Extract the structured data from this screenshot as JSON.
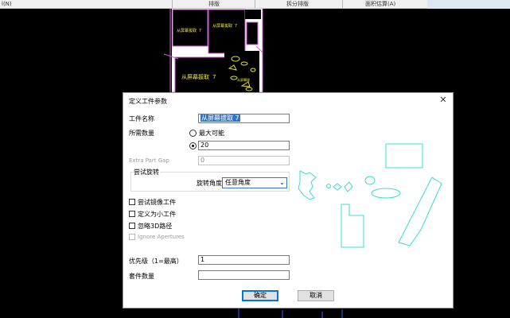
{
  "topbar": {
    "left_text": "l(N)",
    "col1": "排版",
    "col2": "拆分排版",
    "col3": "面积估算(A)"
  },
  "cad": {
    "part_labels": [
      "从屏幕拔取 7",
      "从屏幕拔取 7",
      "从屏幕拔取 7",
      "从屏幕拔"
    ]
  },
  "dialog": {
    "title": "定义工件参数",
    "close_glyph": "✕",
    "part_name_label": "工件名称",
    "part_name_value": "从屏幕拔取 7",
    "quantity_label": "所需数量",
    "max_possible_label": "最大可能",
    "quantity_value": "20",
    "extra_gap_label": "Extra Part Gap",
    "extra_gap_value": "0",
    "rotation_group_label": "尝试旋转",
    "rotation_angle_label": "旋转角度",
    "rotation_angle_value": "任意角度",
    "dropdown_arrow": "⌄",
    "mirror_label": "尝试镜像工件",
    "small_part_label": "定义为小工件",
    "ignore_3d_label": "忽略3D路径",
    "ignore_apertures_label": "Ignore Apertures",
    "priority_label": "优先级（1=最高）",
    "priority_value": "1",
    "kit_quantity_label": "套件数量",
    "kit_quantity_value": "",
    "ok_label": "确定",
    "cancel_label": "取消",
    "quantity_mode": "fixed",
    "preview_color": "#35e0c8"
  }
}
